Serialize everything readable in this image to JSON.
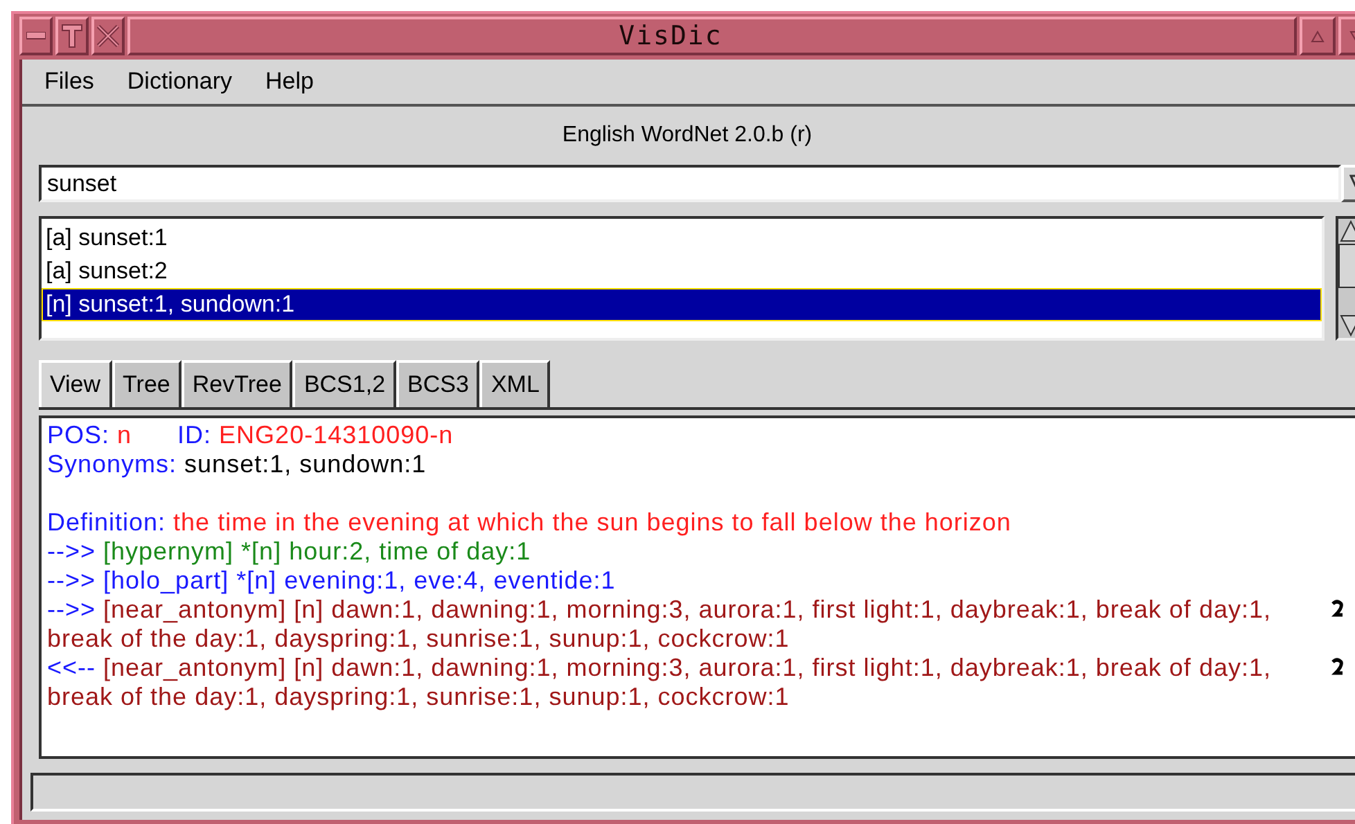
{
  "window": {
    "title": "VisDic"
  },
  "menu": [
    {
      "label": "Files"
    },
    {
      "label": "Dictionary"
    },
    {
      "label": "Help"
    }
  ],
  "dictionary_label": "English WordNet 2.0.b (r)",
  "search": {
    "value": "sunset"
  },
  "results": [
    {
      "label": "[a] sunset:1",
      "selected": false
    },
    {
      "label": "[a] sunset:2",
      "selected": false
    },
    {
      "label": "[n] sunset:1, sundown:1",
      "selected": true
    }
  ],
  "tabs": [
    {
      "label": "View",
      "selected": true
    },
    {
      "label": "Tree",
      "selected": false
    },
    {
      "label": "RevTree",
      "selected": false
    },
    {
      "label": "BCS1,2",
      "selected": false
    },
    {
      "label": "BCS3",
      "selected": false
    },
    {
      "label": "XML",
      "selected": false
    }
  ],
  "entry": [
    {
      "kind": "text",
      "segments": [
        {
          "text": "POS: ",
          "color": "#1a1aff"
        },
        {
          "text": "n",
          "color": "#ff2020"
        },
        {
          "text": "      ID: ",
          "color": "#1a1aff"
        },
        {
          "text": "ENG20-14310090-n",
          "color": "#ff2020"
        }
      ]
    },
    {
      "kind": "text",
      "segments": [
        {
          "text": "Synonyms: ",
          "color": "#1a1aff"
        },
        {
          "text": "sunset:1, sundown:1",
          "color": "#000000"
        }
      ]
    },
    {
      "kind": "blank"
    },
    {
      "kind": "text",
      "segments": [
        {
          "text": "Definition: ",
          "color": "#1a1aff"
        },
        {
          "text": "the time in the evening at which the sun begins to fall below the horizon",
          "color": "#ff2020"
        }
      ]
    },
    {
      "kind": "text",
      "segments": [
        {
          "text": "-->> ",
          "color": "#1a1aff"
        },
        {
          "text": "[hypernym] *[n] hour:2, time of day:1",
          "color": "#1a8a1a"
        }
      ]
    },
    {
      "kind": "text",
      "segments": [
        {
          "text": "-->> ",
          "color": "#1a1aff"
        },
        {
          "text": "[holo_part] *[n] evening:1, eve:4, eventide:1",
          "color": "#1a1aff"
        }
      ]
    },
    {
      "kind": "link",
      "segments": [
        {
          "text": "-->> ",
          "color": "#1a1aff"
        },
        {
          "text": "[near_antonym] [n] dawn:1, dawning:1, morning:3, aurora:1, first light:1, daybreak:1, break of day:1, break of the day:1, dayspring:1, sunrise:1, sunup:1, cockcrow:1",
          "color": "#a01818"
        }
      ]
    },
    {
      "kind": "link",
      "segments": [
        {
          "text": "<<-- ",
          "color": "#1a1aff"
        },
        {
          "text": "[near_antonym] [n] dawn:1, dawning:1, morning:3, aurora:1, first light:1, daybreak:1, break of day:1, break of the day:1, dayspring:1, sunrise:1, sunup:1, cockcrow:1",
          "color": "#a01818"
        }
      ]
    }
  ]
}
